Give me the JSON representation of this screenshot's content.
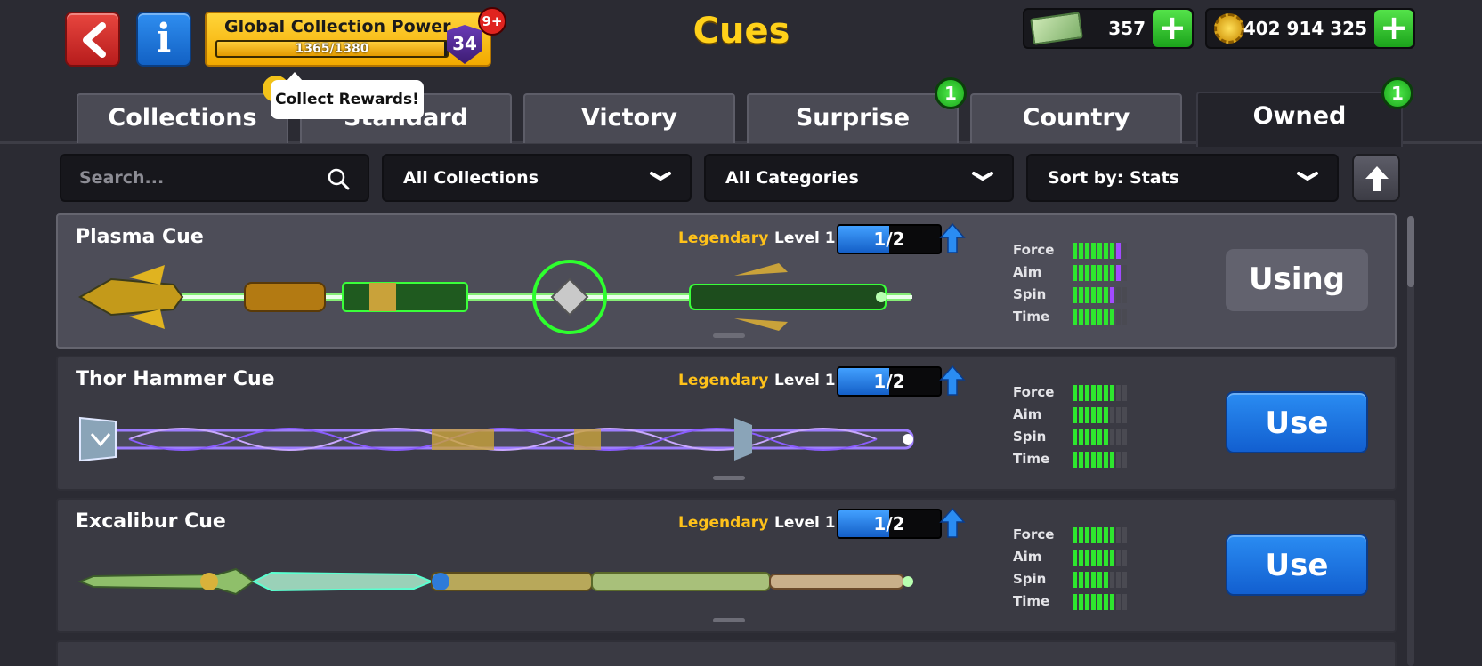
{
  "header": {
    "title": "Cues",
    "global_power": {
      "label": "Global Collection Power",
      "progress_text": "1365/1380",
      "progress_fraction": 0.989,
      "level": "34",
      "notification": "9+"
    },
    "tooltip": "Collect Rewards!",
    "cash": "357",
    "coins": "402 914 325"
  },
  "tabs": [
    {
      "label": "Collections",
      "active": false,
      "badge": ""
    },
    {
      "label": "Standard",
      "active": false,
      "badge": ""
    },
    {
      "label": "Victory",
      "active": false,
      "badge": ""
    },
    {
      "label": "Surprise",
      "active": false,
      "badge": "1"
    },
    {
      "label": "Country",
      "active": false,
      "badge": ""
    },
    {
      "label": "Owned",
      "active": true,
      "badge": "1"
    }
  ],
  "filters": {
    "search_placeholder": "Search...",
    "collections": "All Collections",
    "categories": "All Categories",
    "sort": "Sort by: Stats"
  },
  "stat_labels": [
    "Force",
    "Aim",
    "Spin",
    "Time"
  ],
  "cues": [
    {
      "name": "Plasma Cue",
      "rarity": "Legendary",
      "level": "Level 1",
      "progress": "1/2",
      "progress_fraction": 0.5,
      "stats": [
        {
          "green": 7,
          "purple": 1,
          "max": 9
        },
        {
          "green": 7,
          "purple": 1,
          "max": 9
        },
        {
          "green": 6,
          "purple": 1,
          "max": 9
        },
        {
          "green": 7,
          "purple": 0,
          "max": 9
        }
      ],
      "action": "Using",
      "selected": true
    },
    {
      "name": "Thor Hammer Cue",
      "rarity": "Legendary",
      "level": "Level 1",
      "progress": "1/2",
      "progress_fraction": 0.5,
      "stats": [
        {
          "green": 7,
          "purple": 0,
          "max": 9
        },
        {
          "green": 6,
          "purple": 0,
          "max": 9
        },
        {
          "green": 6,
          "purple": 0,
          "max": 9
        },
        {
          "green": 7,
          "purple": 0,
          "max": 9
        }
      ],
      "action": "Use",
      "selected": false
    },
    {
      "name": "Excalibur Cue",
      "rarity": "Legendary",
      "level": "Level 1",
      "progress": "1/2",
      "progress_fraction": 0.5,
      "stats": [
        {
          "green": 7,
          "purple": 0,
          "max": 9
        },
        {
          "green": 7,
          "purple": 0,
          "max": 9
        },
        {
          "green": 6,
          "purple": 0,
          "max": 9
        },
        {
          "green": 7,
          "purple": 0,
          "max": 9
        }
      ],
      "action": "Use",
      "selected": false
    }
  ],
  "colors": {
    "accent_yellow": "#ffd11a",
    "rarity_legendary": "#ffc21a",
    "stat_green": "#2ee62e",
    "stat_purple": "#a24bff",
    "use_button": "#1a73e0"
  }
}
